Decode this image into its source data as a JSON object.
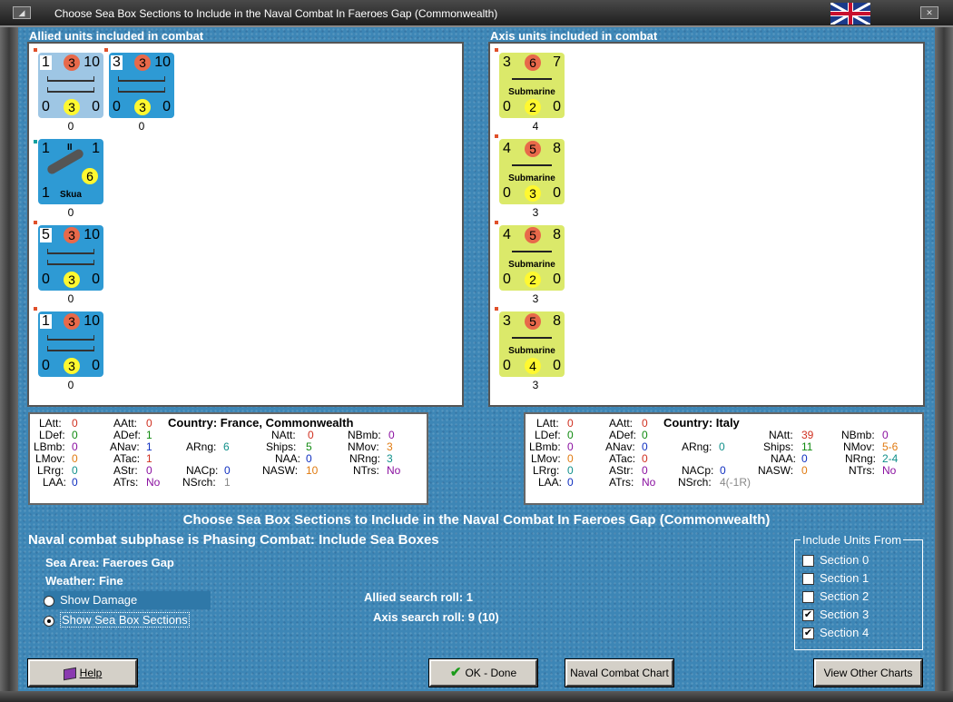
{
  "window": {
    "title": "Choose Sea Box Sections to Include in the Naval Combat In Faeroes Gap (Commonwealth)"
  },
  "allied": {
    "heading": "Allied units included in combat",
    "units": [
      {
        "kind": "ship",
        "tl": "1",
        "tm": "3",
        "tr": "10",
        "bl": "0",
        "bm": "3",
        "br": "0",
        "count": "0",
        "color": "#9ec6e4"
      },
      {
        "kind": "ship",
        "tl": "3",
        "tm": "3",
        "tr": "10",
        "bl": "0",
        "bm": "3",
        "br": "0",
        "count": "0",
        "color": "#2e9ad4"
      },
      {
        "kind": "air",
        "tl": "1",
        "tm": "II",
        "tr": "1",
        "bl": "1",
        "bm": "6",
        "br": "",
        "label": "Skua",
        "count": "0",
        "color": "#2e9ad4"
      },
      {
        "kind": "ship",
        "tl": "5",
        "tm": "3",
        "tr": "10",
        "bl": "0",
        "bm": "3",
        "br": "0",
        "count": "0",
        "color": "#2e9ad4"
      },
      {
        "kind": "ship",
        "tl": "1",
        "tm": "3",
        "tr": "10",
        "bl": "0",
        "bm": "3",
        "br": "0",
        "count": "0",
        "color": "#2e9ad4"
      }
    ],
    "stats": {
      "country": "Country: France, Commonwealth",
      "latt": "LAtt:",
      "latt_v": "0",
      "aatt": "AAtt:",
      "aatt_v": "0",
      "ldef": "LDef:",
      "ldef_v": "0",
      "adef": "ADef:",
      "adef_v": "1",
      "lbmb": "LBmb:",
      "lbmb_v": "0",
      "anav": "ANav:",
      "anav_v": "1",
      "lmov": "LMov:",
      "lmov_v": "0",
      "atac": "ATac:",
      "atac_v": "1",
      "lrrg": "LRrg:",
      "lrrg_v": "0",
      "astr": "AStr:",
      "astr_v": "0",
      "laa": "LAA:",
      "laa_v": "0",
      "atrs": "ATrs:",
      "atrs_v": "No",
      "arng": "ARng:",
      "arng_v": "6",
      "nacp": "NACp:",
      "nacp_v": "0",
      "nsrch": "NSrch:",
      "nsrch_v": "1",
      "natt": "NAtt:",
      "natt_v": "0",
      "ships": "Ships:",
      "ships_v": "5",
      "naa": "NAA:",
      "naa_v": "0",
      "nasw": "NASW:",
      "nasw_v": "10",
      "nbmb": "NBmb:",
      "nbmb_v": "0",
      "nmov": "NMov:",
      "nmov_v": "3",
      "nrng": "NRng:",
      "nrng_v": "3",
      "ntrs": "NTrs:",
      "ntrs_v": "No"
    }
  },
  "axis": {
    "heading": "Axis units included in combat",
    "units": [
      {
        "tl": "3",
        "tm": "6",
        "tr": "7",
        "bl": "0",
        "bm": "2",
        "br": "0",
        "label": "Submarine",
        "count": "4"
      },
      {
        "tl": "4",
        "tm": "5",
        "tr": "8",
        "bl": "0",
        "bm": "3",
        "br": "0",
        "label": "Submarine",
        "count": "3"
      },
      {
        "tl": "4",
        "tm": "5",
        "tr": "8",
        "bl": "0",
        "bm": "2",
        "br": "0",
        "label": "Submarine",
        "count": "3"
      },
      {
        "tl": "3",
        "tm": "5",
        "tr": "8",
        "bl": "0",
        "bm": "4",
        "br": "0",
        "label": "Submarine",
        "count": "3"
      }
    ],
    "stats": {
      "country": "Country: Italy",
      "latt": "LAtt:",
      "latt_v": "0",
      "aatt": "AAtt:",
      "aatt_v": "0",
      "ldef": "LDef:",
      "ldef_v": "0",
      "adef": "ADef:",
      "adef_v": "0",
      "lbmb": "LBmb:",
      "lbmb_v": "0",
      "anav": "ANav:",
      "anav_v": "0",
      "lmov": "LMov:",
      "lmov_v": "0",
      "atac": "ATac:",
      "atac_v": "0",
      "lrrg": "LRrg:",
      "lrrg_v": "0",
      "astr": "AStr:",
      "astr_v": "0",
      "laa": "LAA:",
      "laa_v": "0",
      "atrs": "ATrs:",
      "atrs_v": "No",
      "arng": "ARng:",
      "arng_v": "0",
      "nacp": "NACp:",
      "nacp_v": "0",
      "nsrch": "NSrch:",
      "nsrch_v": "4(-1R)",
      "natt": "NAtt:",
      "natt_v": "39",
      "ships": "Ships:",
      "ships_v": "11",
      "naa": "NAA:",
      "naa_v": "0",
      "nasw": "NASW:",
      "nasw_v": "0",
      "nbmb": "NBmb:",
      "nbmb_v": "0",
      "nmov": "NMov:",
      "nmov_v": "5-6",
      "nrng": "NRng:",
      "nrng_v": "2-4",
      "ntrs": "NTrs:",
      "ntrs_v": "No"
    }
  },
  "main": {
    "heading": "Choose Sea Box Sections to Include in the Naval Combat In Faeroes Gap (Commonwealth)",
    "subphase": "Naval combat subphase is Phasing Combat: Include Sea Boxes",
    "sea_area": "Sea Area:  Faeroes Gap",
    "weather": "Weather:  Fine",
    "show_damage": "Show Damage",
    "show_sections": "Show Sea Box Sections",
    "allied_roll": "Allied search roll:  1",
    "axis_roll": "Axis search roll:  9 (10)"
  },
  "include": {
    "title": "Include Units From",
    "sections": [
      {
        "label": "Section 0",
        "checked": false
      },
      {
        "label": "Section 1",
        "checked": false
      },
      {
        "label": "Section 2",
        "checked": false
      },
      {
        "label": "Section 3",
        "checked": true
      },
      {
        "label": "Section 4",
        "checked": true
      }
    ]
  },
  "buttons": {
    "help": "Help",
    "ok": "OK - Done",
    "chart": "Naval Combat Chart",
    "other": "View Other Charts"
  },
  "colors": {
    "red": "#d03020",
    "green": "#108a10",
    "blue": "#1030c0",
    "teal": "#10908a",
    "purple": "#8a10a0",
    "orange": "#e07a10"
  }
}
